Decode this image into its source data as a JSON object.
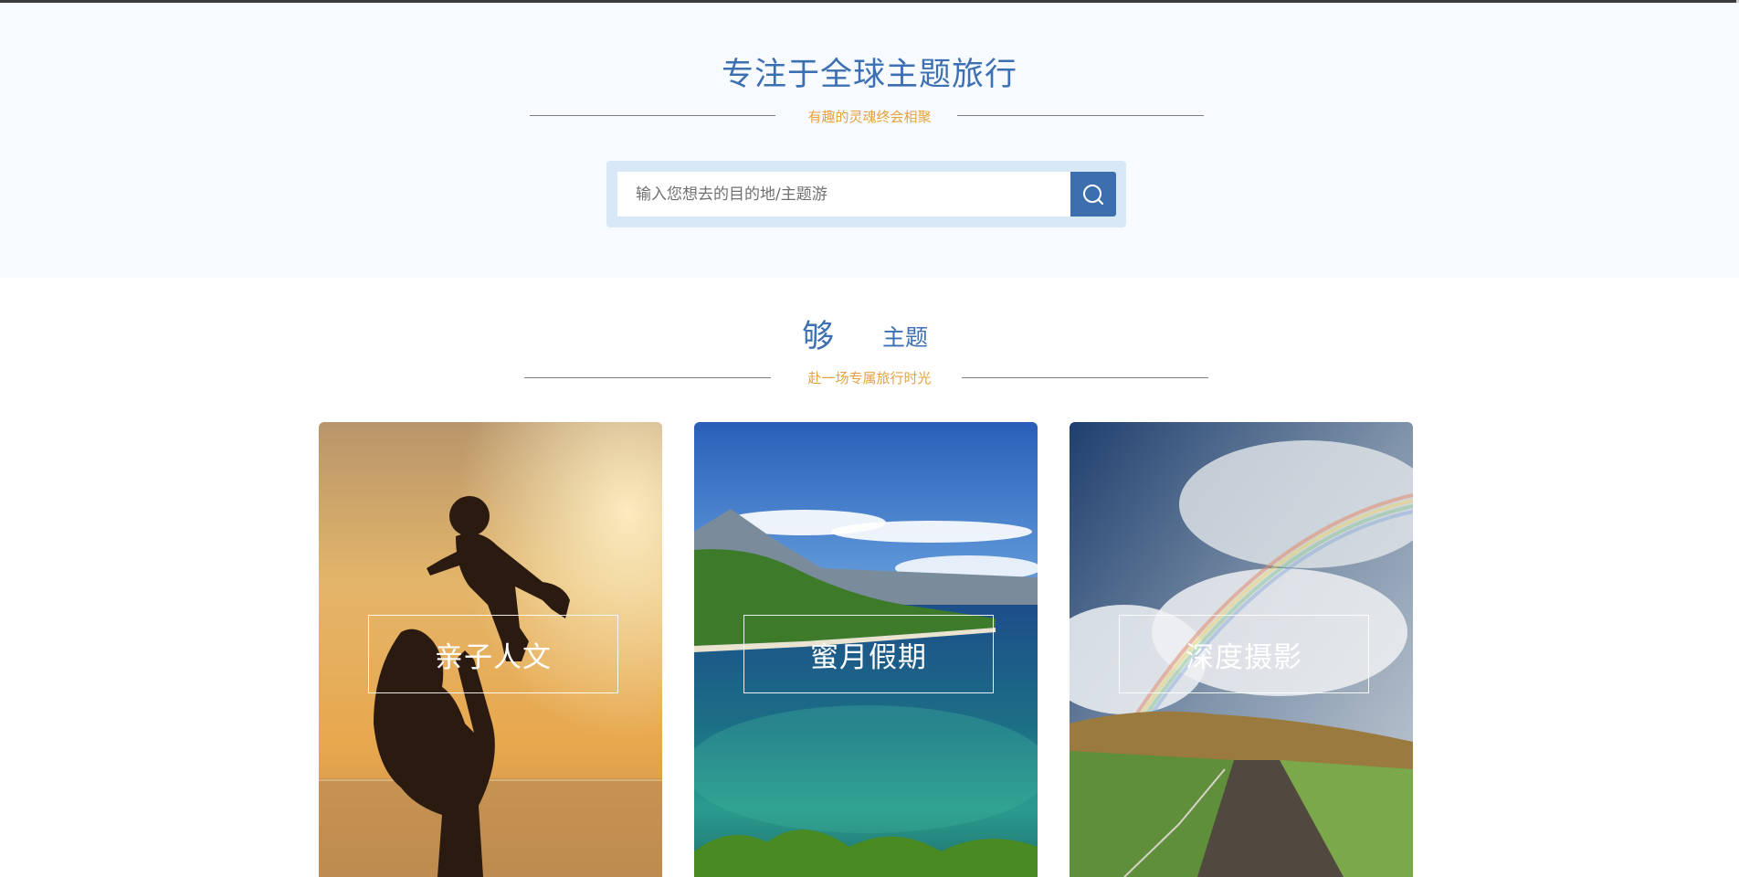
{
  "hero": {
    "title": "专注于全球主题旅行",
    "subtitle": "有趣的灵魂终会相聚"
  },
  "search": {
    "placeholder": "输入您想去的目的地/主题游",
    "value": "",
    "button_icon": "search-icon"
  },
  "themes_section": {
    "title_big": "够",
    "title_small": "主题",
    "subtitle": "赴一场专属旅行时光"
  },
  "cards": [
    {
      "label": "亲子人文",
      "image": "mother-lifting-child-sunset-photo"
    },
    {
      "label": "蜜月假期",
      "image": "tropical-island-coast-photo"
    },
    {
      "label": "深度摄影",
      "image": "rainbow-country-road-photo"
    }
  ],
  "colors": {
    "brand_blue": "#3d70b2",
    "accent_orange": "#e6a23c",
    "hero_bg": "#f7fbff",
    "search_frame": "#d9e8f7"
  }
}
